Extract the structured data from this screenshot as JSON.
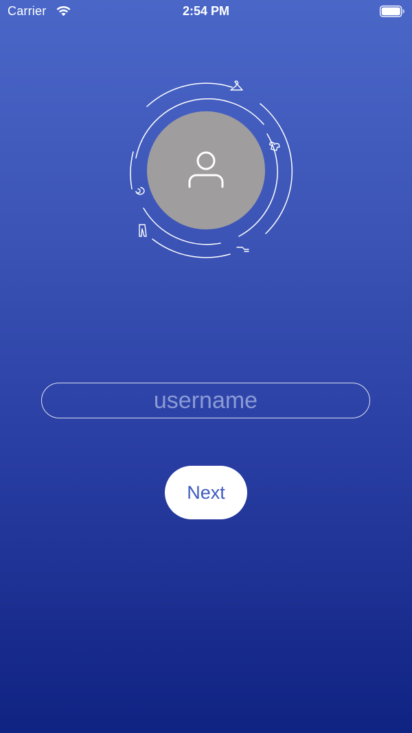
{
  "status_bar": {
    "carrier": "Carrier",
    "time": "2:54 PM",
    "wifi_icon": "wifi-icon",
    "battery_icon": "battery-icon"
  },
  "avatar": {
    "placeholder_icon": "user-icon",
    "ring_icons": [
      "hanger-icon",
      "tshirt-icon",
      "sock-icon",
      "pants-icon",
      "swirl-icon"
    ]
  },
  "form": {
    "username_placeholder": "username",
    "username_value": "",
    "next_label": "Next"
  },
  "colors": {
    "background_top": "#4a67c8",
    "background_bottom": "#0f2383",
    "avatar_fill": "#a09d9f",
    "button_text": "#3e5bc0"
  }
}
